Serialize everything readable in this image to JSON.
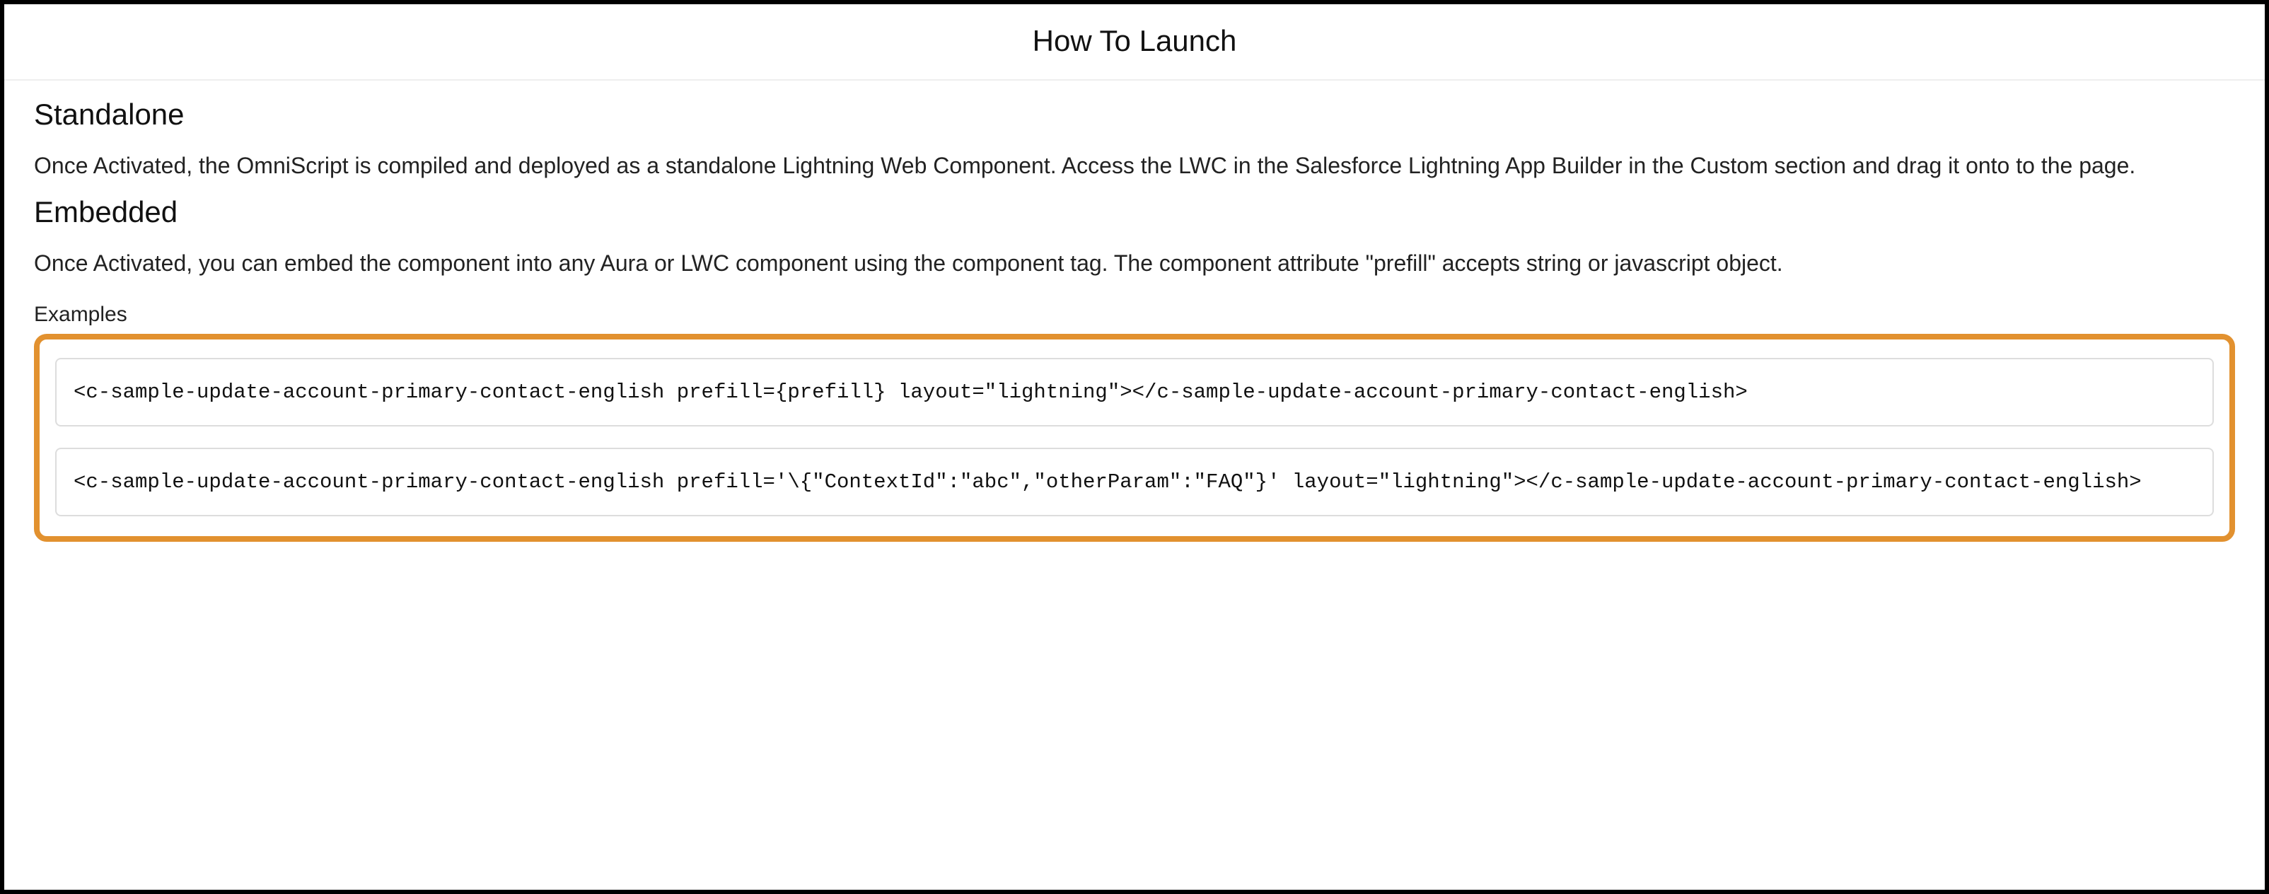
{
  "header": {
    "title": "How To Launch"
  },
  "sections": {
    "standalone": {
      "heading": "Standalone",
      "body": "Once Activated, the OmniScript is compiled and deployed as a standalone Lightning Web Component. Access the LWC in the Salesforce Lightning App Builder in the Custom section and drag it onto to the page."
    },
    "embedded": {
      "heading": "Embedded",
      "body": "Once Activated, you can embed the component into any Aura or LWC component using the component tag. The component attribute \"prefill\" accepts string or javascript object.",
      "examples_label": "Examples",
      "examples": [
        "<c-sample-update-account-primary-contact-english prefill={prefill} layout=\"lightning\"></c-sample-update-account-primary-contact-english>",
        "<c-sample-update-account-primary-contact-english prefill='\\{\"ContextId\":\"abc\",\"otherParam\":\"FAQ\"}' layout=\"lightning\"></c-sample-update-account-primary-contact-english>"
      ]
    }
  },
  "colors": {
    "highlight_border": "#e2912f"
  }
}
